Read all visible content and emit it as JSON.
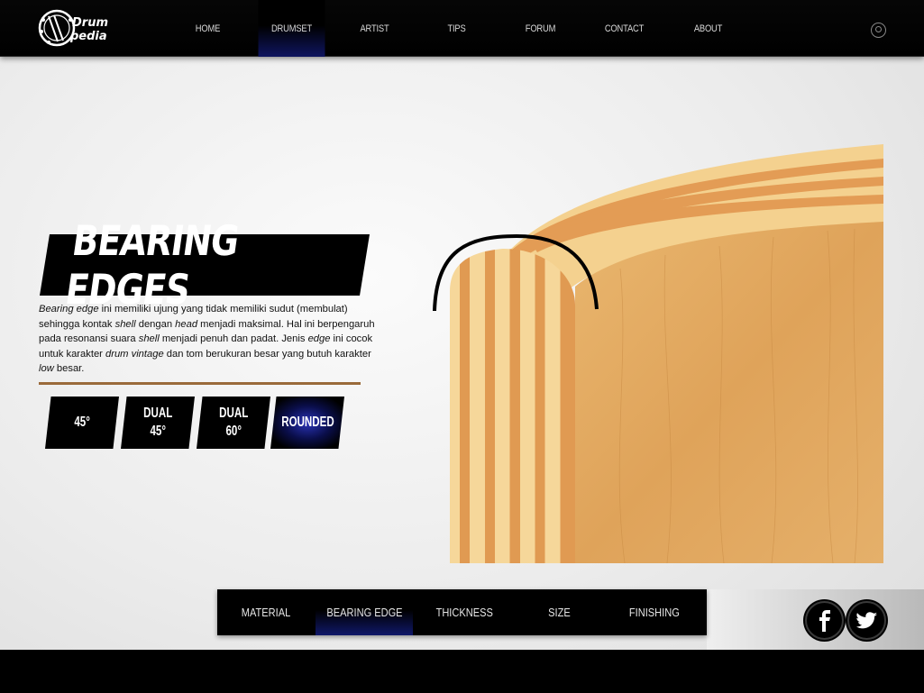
{
  "logo": {
    "line1": "Drum",
    "line2": "pedia"
  },
  "nav": {
    "items": [
      {
        "label": "HOME"
      },
      {
        "label": "DRUMSET"
      },
      {
        "label": "ARTIST"
      },
      {
        "label": "TIPS"
      },
      {
        "label": "FORUM"
      },
      {
        "label": "CONTACT"
      },
      {
        "label": "ABOUT"
      }
    ],
    "active": "DRUMSET",
    "search_icon": "search-icon"
  },
  "section": {
    "title": "BEARING EDGES",
    "description": {
      "s1": "Bearing edge",
      "s2": " ini memiliki ujung yang tidak memiliki sudut (membulat) sehingga kontak ",
      "s3": "shell",
      "s4": " dengan ",
      "s5": "head",
      "s6": " menjadi maksimal. Hal ini berpengaruh pada resonansi suara ",
      "s7": "shell",
      "s8": " menjadi penuh dan padat. Jenis ",
      "s9": "edge",
      "s10": " ini cocok untuk karakter ",
      "s11": "drum vintage",
      "s12": " dan tom berukuran besar yang butuh karakter ",
      "s13": "low",
      "s14": " besar."
    }
  },
  "edge_types": [
    {
      "line1": "45°",
      "line2": ""
    },
    {
      "line1": "DUAL",
      "line2": "45°"
    },
    {
      "line1": "DUAL",
      "line2": "60°"
    },
    {
      "line1": "ROUNDED",
      "line2": ""
    }
  ],
  "edge_active": "ROUNDED",
  "bottom_tabs": [
    {
      "label": "MATERIAL"
    },
    {
      "label": "BEARING EDGE"
    },
    {
      "label": "THICKNESS"
    },
    {
      "label": "SIZE"
    },
    {
      "label": "FINISHING"
    }
  ],
  "bottom_active": "BEARING EDGE",
  "social": [
    {
      "icon": "facebook-icon",
      "glyph": "f"
    },
    {
      "icon": "twitter-icon",
      "glyph": "t"
    }
  ],
  "colors": {
    "nav_active": "#0f1560",
    "accent_divider": "#9a6a3a",
    "wood_light": "#f0c98a",
    "wood_dark": "#d98f45"
  }
}
